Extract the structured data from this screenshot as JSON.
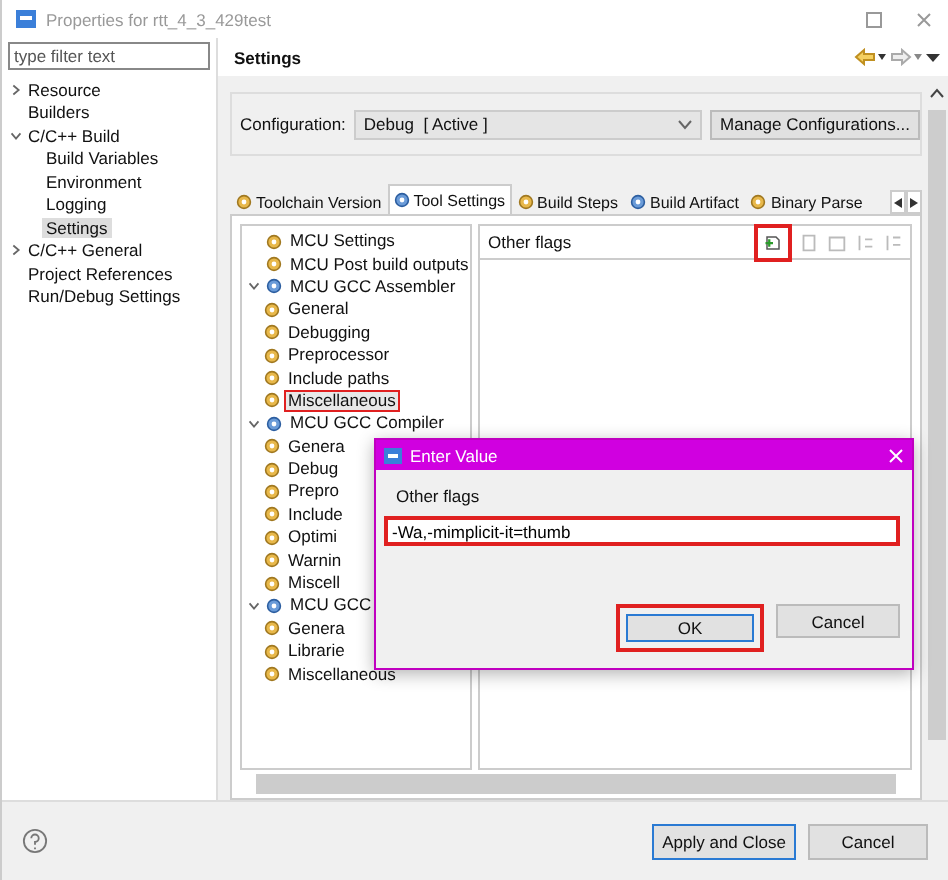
{
  "window": {
    "title": "Properties for rtt_4_3_429test"
  },
  "filter": {
    "placeholder": "type filter text"
  },
  "nav": [
    {
      "label": "Resource",
      "selected": false,
      "expanded": false
    },
    {
      "label": "Builders",
      "selected": false
    },
    {
      "label": "C/C++ Build",
      "selected": false,
      "expanded": true,
      "children": [
        {
          "label": "Build Variables",
          "selected": false
        },
        {
          "label": "Environment",
          "selected": false
        },
        {
          "label": "Logging",
          "selected": false
        },
        {
          "label": "Settings",
          "selected": true
        }
      ]
    },
    {
      "label": "C/C++ General",
      "selected": false,
      "expanded": false
    },
    {
      "label": "Project References",
      "selected": false
    },
    {
      "label": "Run/Debug Settings",
      "selected": false
    }
  ],
  "page_title": "Settings",
  "configuration": {
    "label": "Configuration:",
    "value": "Debug  [ Active ]",
    "button": "Manage Configurations..."
  },
  "tabs": [
    {
      "label": "Toolchain Version",
      "selected": false
    },
    {
      "label": "Tool Settings",
      "selected": true
    },
    {
      "label": "Build Steps",
      "selected": false
    },
    {
      "label": "Build Artifact",
      "selected": false
    },
    {
      "label": "Binary Parse",
      "selected": false
    }
  ],
  "tool_tree": [
    {
      "label": "MCU Settings",
      "selected": false
    },
    {
      "label": "MCU Post build outputs",
      "selected": false
    },
    {
      "label": "MCU GCC Assembler",
      "selected": false,
      "expanded": true,
      "children": [
        {
          "label": "General",
          "selected": false
        },
        {
          "label": "Debugging",
          "selected": false
        },
        {
          "label": "Preprocessor",
          "selected": false
        },
        {
          "label": "Include paths",
          "selected": false
        },
        {
          "label": "Miscellaneous",
          "selected": true,
          "highlighted": true
        }
      ]
    },
    {
      "label": "MCU GCC Compiler",
      "selected": false,
      "expanded": true,
      "children": [
        {
          "label": "Genera",
          "selected": false
        },
        {
          "label": "Debug",
          "selected": false
        },
        {
          "label": "Prepro",
          "selected": false
        },
        {
          "label": "Include",
          "selected": false
        },
        {
          "label": "Optimi",
          "selected": false
        },
        {
          "label": "Warnin",
          "selected": false
        },
        {
          "label": "Miscell",
          "selected": false
        }
      ]
    },
    {
      "label": "MCU GCC",
      "selected": false,
      "expanded": true,
      "children": [
        {
          "label": "Genera",
          "selected": false
        },
        {
          "label": "Librarie",
          "selected": false
        },
        {
          "label": "Miscellaneous",
          "selected": false
        }
      ]
    }
  ],
  "flags_panel": {
    "title": "Other flags",
    "toolbar": [
      {
        "disabled": false,
        "highlighted": true
      },
      {
        "disabled": true,
        "highlighted": false
      },
      {
        "disabled": true,
        "highlighted": false
      },
      {
        "disabled": true,
        "highlighted": false
      },
      {
        "disabled": true,
        "highlighted": false
      }
    ]
  },
  "dialog": {
    "title": "Enter Value",
    "label": "Other flags",
    "value": "-Wa,-mimplicit-it=thumb",
    "value_highlighted": true,
    "buttons": [
      {
        "label": "OK",
        "highlighted": true
      },
      {
        "label": "Cancel",
        "highlighted": false
      }
    ]
  },
  "footer": {
    "buttons": [
      {
        "label": "Apply and Close",
        "default": true
      },
      {
        "label": "Cancel",
        "default": false
      }
    ]
  }
}
